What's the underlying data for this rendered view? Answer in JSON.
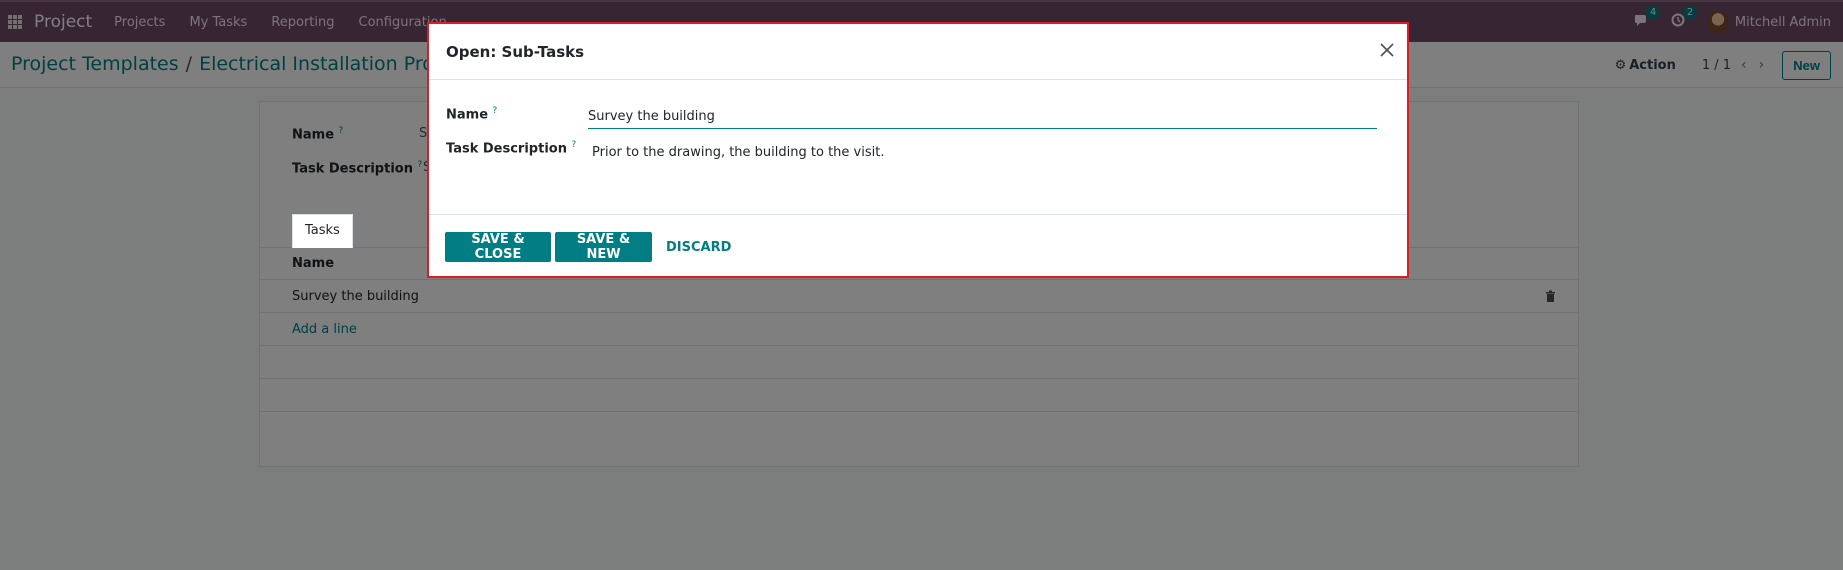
{
  "navbar": {
    "app_name": "Project",
    "menu": [
      "Projects",
      "My Tasks",
      "Reporting",
      "Configuration"
    ],
    "messages_count": "4",
    "activities_count": "2",
    "user_name": "Mitchell Admin"
  },
  "control_panel": {
    "breadcrumb": [
      "Project Templates",
      "Electrical Installation Project"
    ],
    "breadcrumb_separator": "/",
    "action_label": "Action",
    "pager": "1 / 1",
    "new_label": "New"
  },
  "form": {
    "name_label": "Name",
    "name_value": "S",
    "description_label": "Task Description",
    "description_value": "S",
    "tab_label": "Tasks",
    "list_header_name": "Name",
    "rows": [
      "Survey the building"
    ],
    "add_line_label": "Add a line"
  },
  "dialog": {
    "title": "Open: Sub-Tasks",
    "name_label": "Name",
    "name_value": "Survey the building",
    "description_label": "Task Description",
    "description_value": "Prior to the drawing, the building to the visit.",
    "save_close_label": "SAVE & CLOSE",
    "save_new_label": "SAVE & NEW",
    "discard_label": "DISCARD"
  },
  "colors": {
    "navbar": "#714b67",
    "primary": "#017e84",
    "dialog_border": "#e01b24"
  }
}
